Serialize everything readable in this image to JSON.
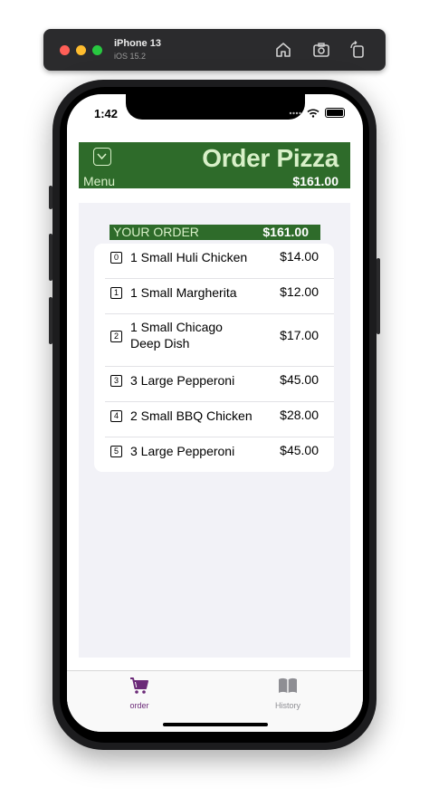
{
  "simulator": {
    "device_name": "iPhone 13",
    "os_version": "iOS 15.2",
    "icons": [
      "home-icon",
      "screenshot-icon",
      "rotate-icon"
    ]
  },
  "status_bar": {
    "time": "1:42"
  },
  "header": {
    "title": "Order Pizza",
    "menu_label": "Menu",
    "total": "$161.00",
    "bg_color": "#2e6b2a",
    "text_color": "#d8f0c8"
  },
  "order_summary": {
    "label": "YOUR ORDER",
    "total": "$161.00"
  },
  "order_items": [
    {
      "index": "0",
      "description": "1 Small Huli Chicken",
      "price": "$14.00"
    },
    {
      "index": "1",
      "description": "1 Small Margherita",
      "price": "$12.00"
    },
    {
      "index": "2",
      "description": "1 Small Chicago\nDeep Dish",
      "price": "$17.00"
    },
    {
      "index": "3",
      "description": "3 Large Pepperoni",
      "price": "$45.00"
    },
    {
      "index": "4",
      "description": "2 Small BBQ Chicken",
      "price": "$28.00"
    },
    {
      "index": "5",
      "description": "3 Large Pepperoni",
      "price": "$45.00"
    }
  ],
  "tabs": [
    {
      "label": "order",
      "icon": "cart-icon",
      "selected": true,
      "color": "#6b2a78"
    },
    {
      "label": "History",
      "icon": "book-icon",
      "selected": false,
      "color": "#8e8e93"
    }
  ]
}
